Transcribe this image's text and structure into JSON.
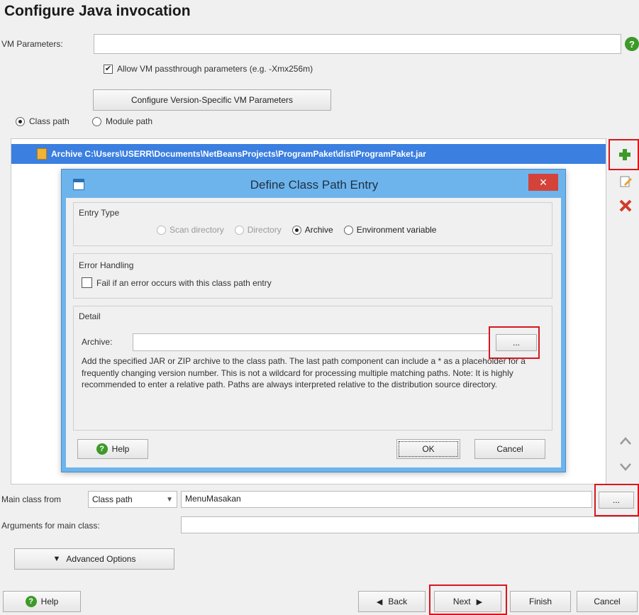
{
  "page_title": "Configure Java invocation",
  "vm": {
    "label": "VM Parameters:",
    "value": "",
    "allow_passthrough_label": "Allow VM passthrough parameters (e.g. -Xmx256m)",
    "allow_passthrough_checked": true,
    "config_button": "Configure Version-Specific VM Parameters"
  },
  "path_mode": {
    "class_path": "Class path",
    "module_path": "Module path",
    "selected": "Class path"
  },
  "classpath_list": {
    "items": [
      "Archive C:\\Users\\USERR\\Documents\\NetBeansProjects\\ProgramPaket\\dist\\ProgramPaket.jar"
    ]
  },
  "side_icons": [
    "add-icon",
    "edit-icon",
    "delete-icon",
    "move-up-icon",
    "move-down-icon"
  ],
  "dialog": {
    "title": "Define Class Path Entry",
    "close_glyph": "×",
    "entry_type": {
      "title": "Entry Type",
      "options": [
        "Scan directory",
        "Directory",
        "Archive",
        "Environment variable"
      ],
      "selected": "Archive"
    },
    "error_handling": {
      "title": "Error Handling",
      "fail_label": "Fail if an error occurs with this class path entry",
      "fail_checked": false
    },
    "detail": {
      "title": "Detail",
      "archive_label": "Archive:",
      "archive_value": "",
      "browse_label": "...",
      "description": "Add the specified JAR or ZIP archive to the class path. The last path component can include a * as a placeholder for a frequently changing version number. This is not a wildcard for processing multiple matching paths. Note: It is highly recommended to enter a relative path. Paths are always interpreted relative to the distribution source directory."
    },
    "buttons": {
      "help": "Help",
      "ok": "OK",
      "cancel": "Cancel"
    }
  },
  "main_class": {
    "label": "Main class from",
    "source": "Class path",
    "value": "MenuMasakan",
    "browse_label": "..."
  },
  "arguments": {
    "label": "Arguments for main class:",
    "value": ""
  },
  "advanced_button": "Advanced Options",
  "footer": {
    "help": "Help",
    "back": "Back",
    "next": "Next",
    "finish": "Finish",
    "cancel": "Cancel"
  },
  "colors": {
    "selection": "#3b7fe0",
    "highlight_red": "#d9161f",
    "dialog_title_bg": "#6eb4ec",
    "close_button": "#d3433a",
    "green_icon": "#3d9a29"
  }
}
